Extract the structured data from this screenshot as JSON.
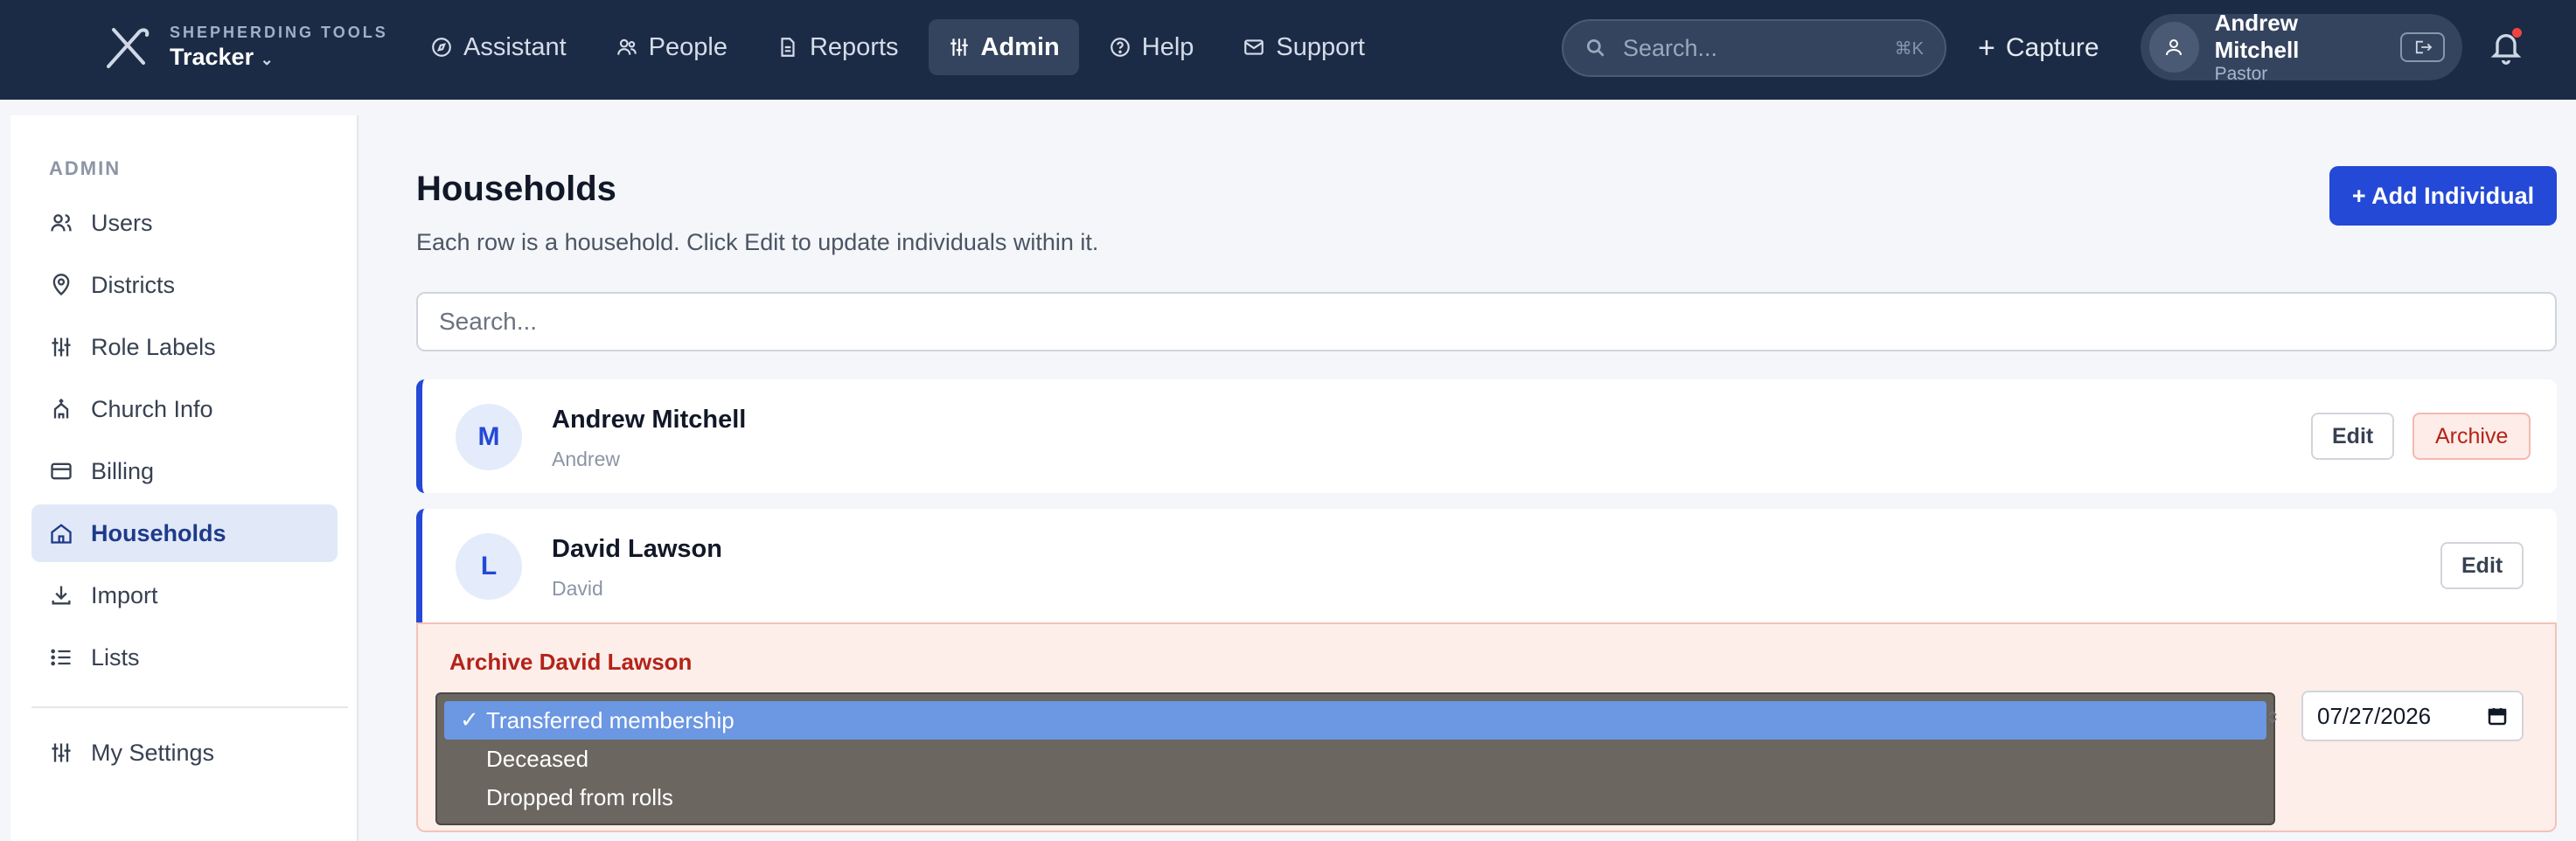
{
  "topbar": {
    "brand_small": "SHEPHERDING TOOLS",
    "brand_name": "Tracker",
    "nav": [
      {
        "label": "Assistant",
        "icon": "compass-icon"
      },
      {
        "label": "People",
        "icon": "people-icon"
      },
      {
        "label": "Reports",
        "icon": "document-icon"
      },
      {
        "label": "Admin",
        "icon": "sliders-icon",
        "active": true
      },
      {
        "label": "Help",
        "icon": "help-icon"
      },
      {
        "label": "Support",
        "icon": "mail-icon"
      }
    ],
    "search_placeholder": "Search...",
    "search_shortcut": "⌘K",
    "capture_label": "Capture",
    "user_name": "Andrew Mitchell",
    "user_role": "Pastor"
  },
  "sidebar": {
    "section_title": "ADMIN",
    "items": [
      {
        "label": "Users",
        "icon": "users-icon"
      },
      {
        "label": "Districts",
        "icon": "map-pin-icon"
      },
      {
        "label": "Role Labels",
        "icon": "sliders-icon"
      },
      {
        "label": "Church Info",
        "icon": "church-icon"
      },
      {
        "label": "Billing",
        "icon": "credit-card-icon"
      },
      {
        "label": "Households",
        "icon": "home-icon",
        "active": true
      },
      {
        "label": "Import",
        "icon": "download-icon"
      },
      {
        "label": "Lists",
        "icon": "list-icon"
      }
    ],
    "settings_label": "My Settings"
  },
  "main": {
    "title": "Households",
    "subtitle": "Each row is a household. Click Edit to update individuals within it.",
    "add_button": "+ Add Individual",
    "search_placeholder": "Search...",
    "households": [
      {
        "initial": "M",
        "name": "Andrew Mitchell",
        "sub": "Andrew",
        "edit": "Edit",
        "archive": "Archive"
      },
      {
        "initial": "L",
        "name": "David Lawson",
        "sub": "David",
        "edit": "Edit"
      }
    ],
    "archive_panel": {
      "title": "Archive David Lawson",
      "date_value": "07/27/2026",
      "reason_options": [
        "Transferred membership",
        "Deceased",
        "Dropped from rolls"
      ],
      "selected_index": 0
    }
  },
  "colors": {
    "topbar": "#1c2b45",
    "accent": "#2449d6",
    "archive_bg": "#fdeeea",
    "archive_text": "#b42318"
  }
}
